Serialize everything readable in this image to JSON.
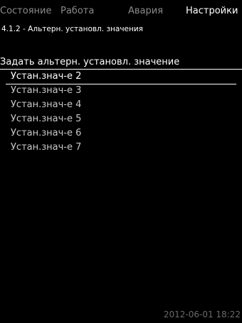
{
  "tabs": [
    {
      "label": "Состояние"
    },
    {
      "label": "Работа"
    },
    {
      "label": "Авария"
    },
    {
      "label": "Настройки"
    }
  ],
  "breadcrumb": "4.1.2 - Альтерн. установл. значения",
  "section_title": "Задать альтерн. установл. значение",
  "items": [
    {
      "label": "Устан.знач-е 2"
    },
    {
      "label": "Устан.знач-е 3"
    },
    {
      "label": "Устан.знач-е 4"
    },
    {
      "label": "Устан.знач-е 5"
    },
    {
      "label": "Устан.знач-е 6"
    },
    {
      "label": "Устан.знач-е 7"
    }
  ],
  "timestamp": "2012-06-01 18:22",
  "colors": {
    "background": "#000000",
    "active_text": "#ffffff",
    "inactive_tab": "#8a8a8a",
    "timestamp": "#6a6a6a"
  }
}
